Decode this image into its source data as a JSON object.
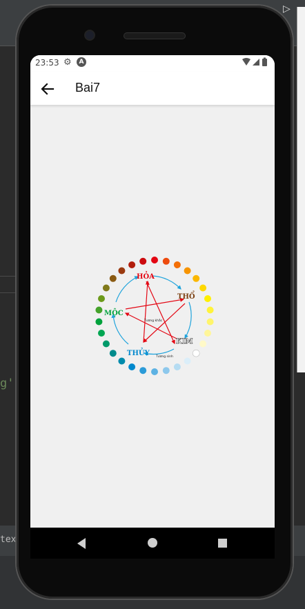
{
  "ide": {
    "code_quote": "g'",
    "code_brace": "}",
    "bottom_text": "text",
    "top_icon": "▷"
  },
  "status_bar": {
    "time": "23:53",
    "gear_icon": "⚙",
    "a_icon": "A",
    "right_icons": "▼◢▮"
  },
  "app_bar": {
    "title": "Bai7"
  },
  "diagram": {
    "elements": {
      "hoa": "HỎA",
      "tho": "THỔ",
      "kim": "KIM",
      "thuy": "THỦY",
      "moc": "MỘC"
    },
    "tuong_khac": "Tương khắc",
    "tuong_sinh": "Tương sinh",
    "dot_colors": [
      "#e30613",
      "#ed4b0e",
      "#f36f07",
      "#f79400",
      "#fbb700",
      "#ffd800",
      "#fff000",
      "#fff33b",
      "#fff56b",
      "#fff69a",
      "#fff9c8",
      "#ffffff",
      "#dbeef9",
      "#b5dcf2",
      "#8dc8ec",
      "#5db2e3",
      "#2b9bd8",
      "#0088cd",
      "#008bac",
      "#008b8c",
      "#009a6a",
      "#00a652",
      "#00a23c",
      "#44a22a",
      "#6b9a1a",
      "#80791a",
      "#8a5a12",
      "#9a3a10",
      "#b21d0c",
      "#cc0b0f"
    ]
  }
}
